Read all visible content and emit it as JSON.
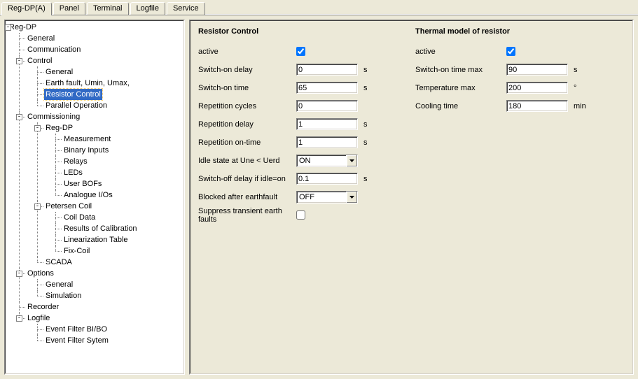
{
  "tabs": {
    "items": [
      {
        "label": "Reg-DP(A)",
        "active": true
      },
      {
        "label": "Panel",
        "active": false
      },
      {
        "label": "Terminal",
        "active": false
      },
      {
        "label": "Logfile",
        "active": false
      },
      {
        "label": "Service",
        "active": false
      }
    ]
  },
  "tree": {
    "root": "Reg-DP",
    "general": "General",
    "communication": "Communication",
    "control": "Control",
    "control_general": "General",
    "control_earth": "Earth fault, Umin, Umax,",
    "control_resistor": "Resistor Control",
    "control_parallel": "Parallel Operation",
    "commissioning": "Commissioning",
    "com_regdp": "Reg-DP",
    "com_measurement": "Measurement",
    "com_binary": "Binary Inputs",
    "com_relays": "Relays",
    "com_leds": "LEDs",
    "com_userbofs": "User BOFs",
    "com_analogue": "Analogue I/Os",
    "petersen": "Petersen Coil",
    "pc_coildata": "Coil Data",
    "pc_results": "Results of Calibration",
    "pc_lin": "Linearization Table",
    "pc_fixcoil": "Fix-Coil",
    "scada": "SCADA",
    "options": "Options",
    "opt_general": "General",
    "opt_sim": "Simulation",
    "recorder": "Recorder",
    "logfile": "Logfile",
    "lf_bi": "Event Filter BI/BO",
    "lf_sys": "Event Filter Sytem"
  },
  "glyph": {
    "minus": "-",
    "plus": "+"
  },
  "form": {
    "resistor": {
      "title": "Resistor Control",
      "active_label": "active",
      "active": true,
      "switch_on_delay_label": "Switch-on delay",
      "switch_on_delay": "0",
      "switch_on_time_label": "Switch-on time",
      "switch_on_time": "65",
      "rep_cycles_label": "Repetition cycles",
      "rep_cycles": "0",
      "rep_delay_label": "Repetition delay",
      "rep_delay": "1",
      "rep_ontime_label": "Repetition on-time",
      "rep_ontime": "1",
      "idle_label": "Idle state at Une < Uerd",
      "idle_value": "ON",
      "switchoff_delay_label": "Switch-off delay if idle=on",
      "switchoff_delay": "0.1",
      "blocked_label": "Blocked after earthfault",
      "blocked_value": "OFF",
      "suppress_label": "Suppress transient earth faults",
      "suppress": false,
      "unit_s": "s"
    },
    "thermal": {
      "title": "Thermal model of resistor",
      "active_label": "active",
      "active": true,
      "switch_on_max_label": "Switch-on time max",
      "switch_on_max": "90",
      "temp_max_label": "Temperature max",
      "temp_max": "200",
      "cooling_label": "Cooling time",
      "cooling": "180",
      "unit_s": "s",
      "unit_deg": "°",
      "unit_min": "min"
    }
  }
}
